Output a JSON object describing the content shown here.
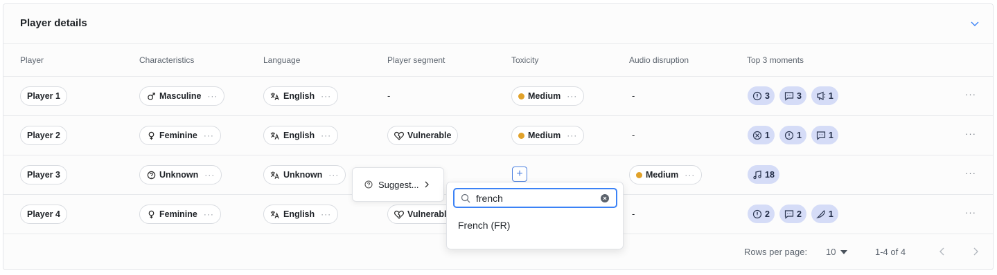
{
  "card": {
    "title": "Player details"
  },
  "columns": [
    "Player",
    "Characteristics",
    "Language",
    "Player segment",
    "Toxicity",
    "Audio disruption",
    "Top 3 moments"
  ],
  "rows": [
    {
      "player": "Player 1",
      "characteristic": "Masculine",
      "characteristic_icon": "male-icon",
      "language": "English",
      "segment": "-",
      "toxicity": "Medium",
      "audio": "-",
      "moments": [
        {
          "icon": "alert-icon",
          "count": "3"
        },
        {
          "icon": "chat-icon",
          "count": "3"
        },
        {
          "icon": "megaphone-icon",
          "count": "1"
        }
      ]
    },
    {
      "player": "Player 2",
      "characteristic": "Feminine",
      "characteristic_icon": "female-icon",
      "language": "English",
      "segment": "Vulnerable",
      "toxicity": "Medium",
      "audio": "-",
      "moments": [
        {
          "icon": "blocked-icon",
          "count": "1"
        },
        {
          "icon": "alert-icon",
          "count": "1"
        },
        {
          "icon": "chat-icon",
          "count": "1"
        }
      ]
    },
    {
      "player": "Player 3",
      "characteristic": "Unknown",
      "characteristic_icon": "unknown-icon",
      "language": "Unknown",
      "segment": "",
      "toxicity": "",
      "audio": "Medium",
      "moments": [
        {
          "icon": "music-icon",
          "count": "18"
        }
      ]
    },
    {
      "player": "Player 4",
      "characteristic": "Feminine",
      "characteristic_icon": "female-icon",
      "language": "English",
      "segment": "Vulnerable",
      "toxicity": "",
      "audio": "-",
      "moments": [
        {
          "icon": "alert-icon",
          "count": "2"
        },
        {
          "icon": "chat-icon",
          "count": "2"
        },
        {
          "icon": "knife-icon",
          "count": "1"
        }
      ]
    }
  ],
  "row_more": "···",
  "pill_more": "···",
  "suggest": {
    "label": "Suggest..."
  },
  "language_search": {
    "value": "french",
    "option": "French (FR)"
  },
  "footer": {
    "rows_per_page_label": "Rows per page:",
    "rows_per_page_value": "10",
    "range": "1-4 of 4"
  },
  "colors": {
    "accent": "#3b82f6",
    "medium_dot": "#e1a22a",
    "moment_chip": "#d5dcf7"
  }
}
